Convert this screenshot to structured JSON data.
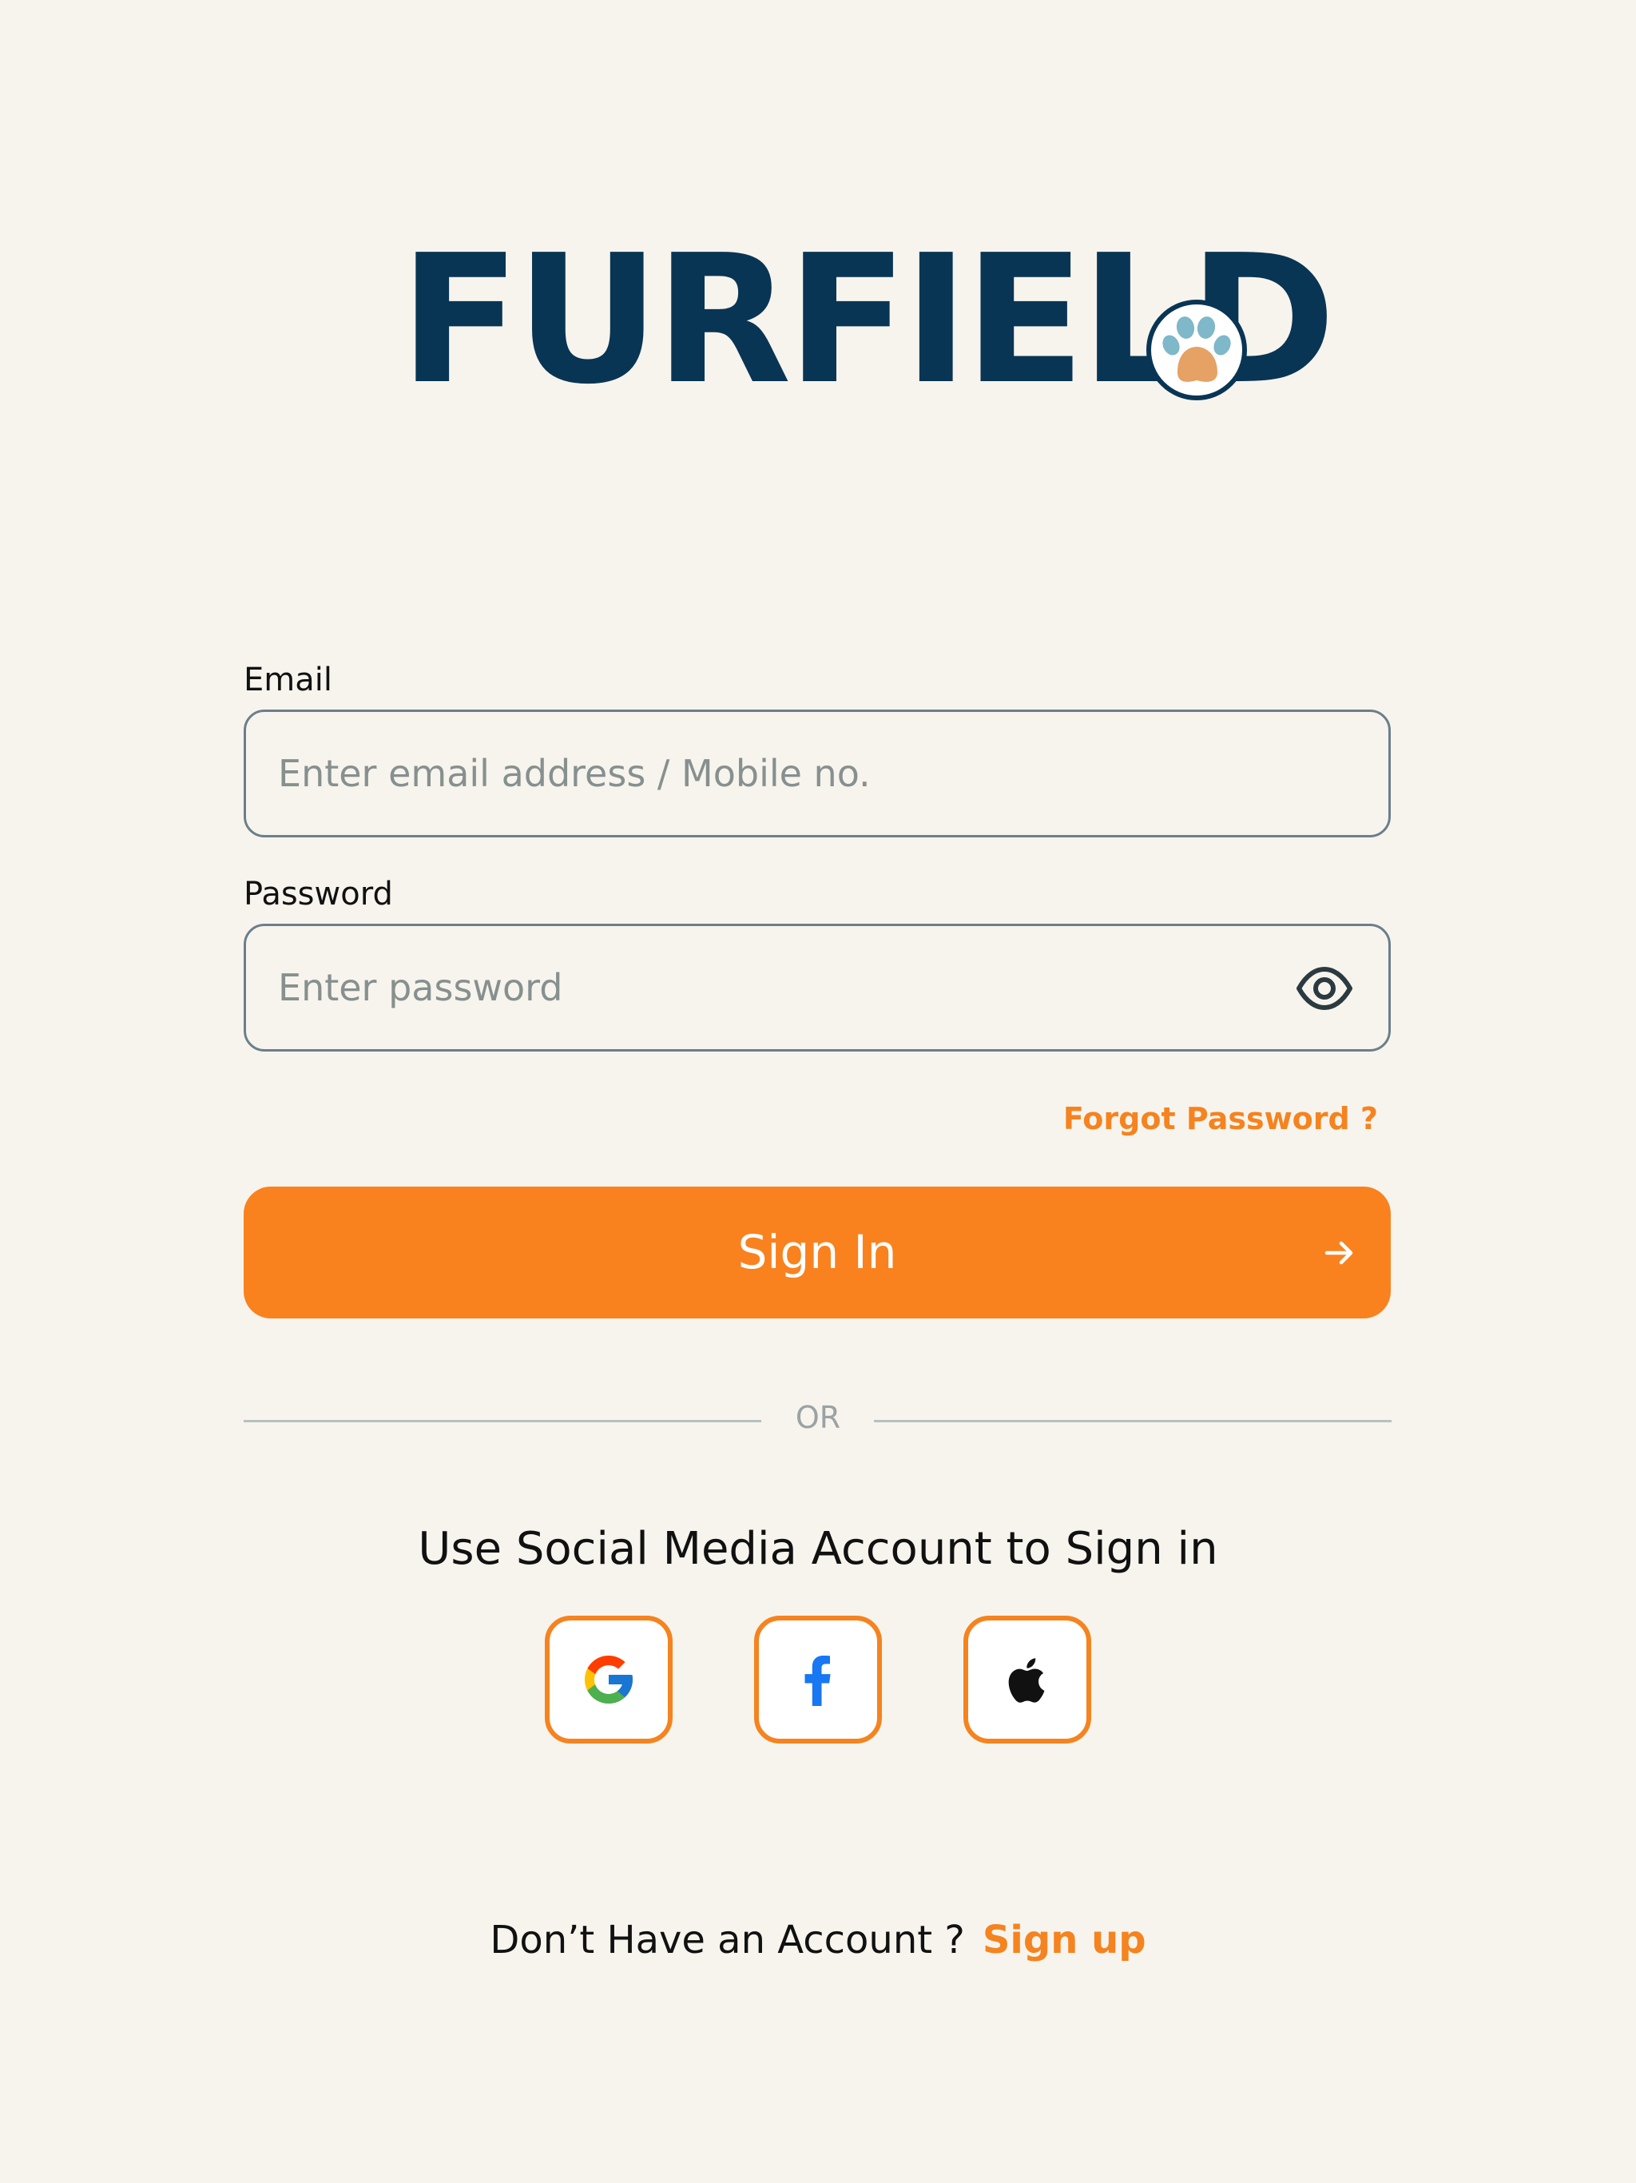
{
  "brand": {
    "name": "FURFIELD",
    "colors": {
      "navy": "#093555",
      "orange": "#f9821e",
      "paw_blue": "#7fb8c8",
      "paw_pad": "#e5a264",
      "background": "#f7f4ed"
    }
  },
  "form": {
    "email": {
      "label": "Email",
      "placeholder": "Enter email address / Mobile no.",
      "value": ""
    },
    "password": {
      "label": "Password",
      "placeholder": "Enter password",
      "value": "",
      "toggle_icon": "eye-icon"
    },
    "forgot_password": "Forgot Password ?",
    "sign_in_label": "Sign In",
    "sign_in_icon": "arrow-right-icon"
  },
  "divider": {
    "label": "OR"
  },
  "social": {
    "title": "Use Social Media Account to Sign in",
    "providers": [
      {
        "name": "Google",
        "icon": "google-icon"
      },
      {
        "name": "Facebook",
        "icon": "facebook-icon"
      },
      {
        "name": "Apple",
        "icon": "apple-icon"
      }
    ]
  },
  "footer": {
    "prompt": "Don’t Have an Account ?",
    "signup_label": "Sign up"
  }
}
